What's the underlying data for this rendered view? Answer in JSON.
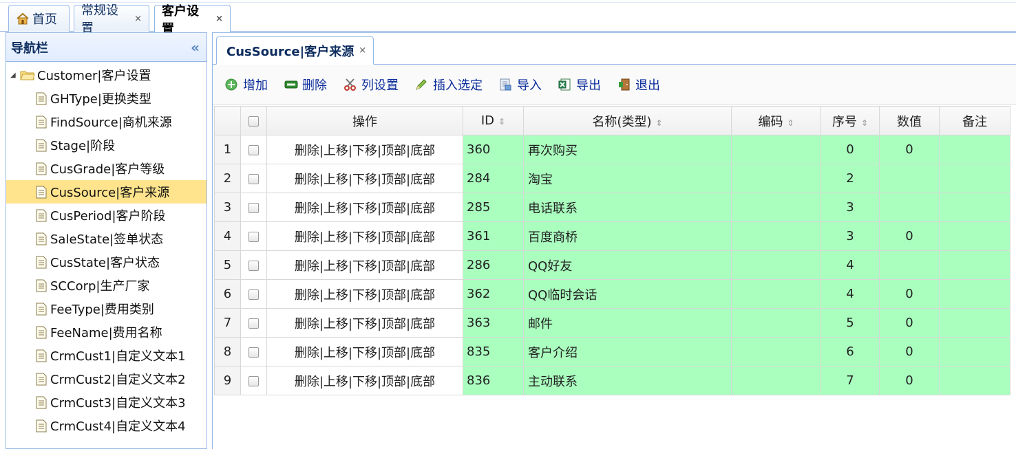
{
  "top_tabs": [
    {
      "label": "首页",
      "closable": false
    },
    {
      "label": "常规设置",
      "closable": true
    },
    {
      "label": "客户设置",
      "closable": true,
      "active": true
    }
  ],
  "nav": {
    "title": "导航栏",
    "collapse_glyph": "«",
    "root": "Customer|客户设置",
    "items": [
      "GHType|更换类型",
      "FindSource|商机来源",
      "Stage|阶段",
      "CusGrade|客户等级",
      "CusSource|客户来源",
      "CusPeriod|客户阶段",
      "SaleState|签单状态",
      "CusState|客户状态",
      "SCCorp|生产厂家",
      "FeeType|费用类别",
      "FeeName|费用名称",
      "CrmCust1|自定义文本1",
      "CrmCust2|自定义文本2",
      "CrmCust3|自定义文本3",
      "CrmCust4|自定义文本4"
    ],
    "selected_index": 4
  },
  "inner_tab": {
    "label": "CusSource|客户来源",
    "close": "×"
  },
  "toolbar": {
    "add": "增加",
    "delete": "删除",
    "columns": "列设置",
    "insert": "插入选定",
    "import": "导入",
    "export": "导出",
    "exit": "退出"
  },
  "close_glyph": "×",
  "grid": {
    "headers": {
      "op": "操作",
      "id": "ID",
      "name": "名称(类型)",
      "code": "编码",
      "seq": "序号",
      "value": "数值",
      "note": "备注"
    },
    "op_text": "删除|上移|下移|顶部|底部",
    "rows": [
      {
        "n": "1",
        "id": "360",
        "name": "再次购买",
        "code": "",
        "seq": "0",
        "value": "0",
        "note": ""
      },
      {
        "n": "2",
        "id": "284",
        "name": "淘宝",
        "code": "",
        "seq": "2",
        "value": "",
        "note": ""
      },
      {
        "n": "3",
        "id": "285",
        "name": "电话联系",
        "code": "",
        "seq": "3",
        "value": "",
        "note": ""
      },
      {
        "n": "4",
        "id": "361",
        "name": "百度商桥",
        "code": "",
        "seq": "3",
        "value": "0",
        "note": ""
      },
      {
        "n": "5",
        "id": "286",
        "name": "QQ好友",
        "code": "",
        "seq": "4",
        "value": "",
        "note": ""
      },
      {
        "n": "6",
        "id": "362",
        "name": "QQ临时会话",
        "code": "",
        "seq": "4",
        "value": "0",
        "note": ""
      },
      {
        "n": "7",
        "id": "363",
        "name": "邮件",
        "code": "",
        "seq": "5",
        "value": "0",
        "note": ""
      },
      {
        "n": "8",
        "id": "835",
        "name": "客户介绍",
        "code": "",
        "seq": "6",
        "value": "0",
        "note": ""
      },
      {
        "n": "9",
        "id": "836",
        "name": "主动联系",
        "code": "",
        "seq": "7",
        "value": "0",
        "note": ""
      }
    ]
  },
  "colors": {
    "border": "#95b8e7",
    "row_green": "#aaffbf",
    "selected": "#ffe48d"
  }
}
